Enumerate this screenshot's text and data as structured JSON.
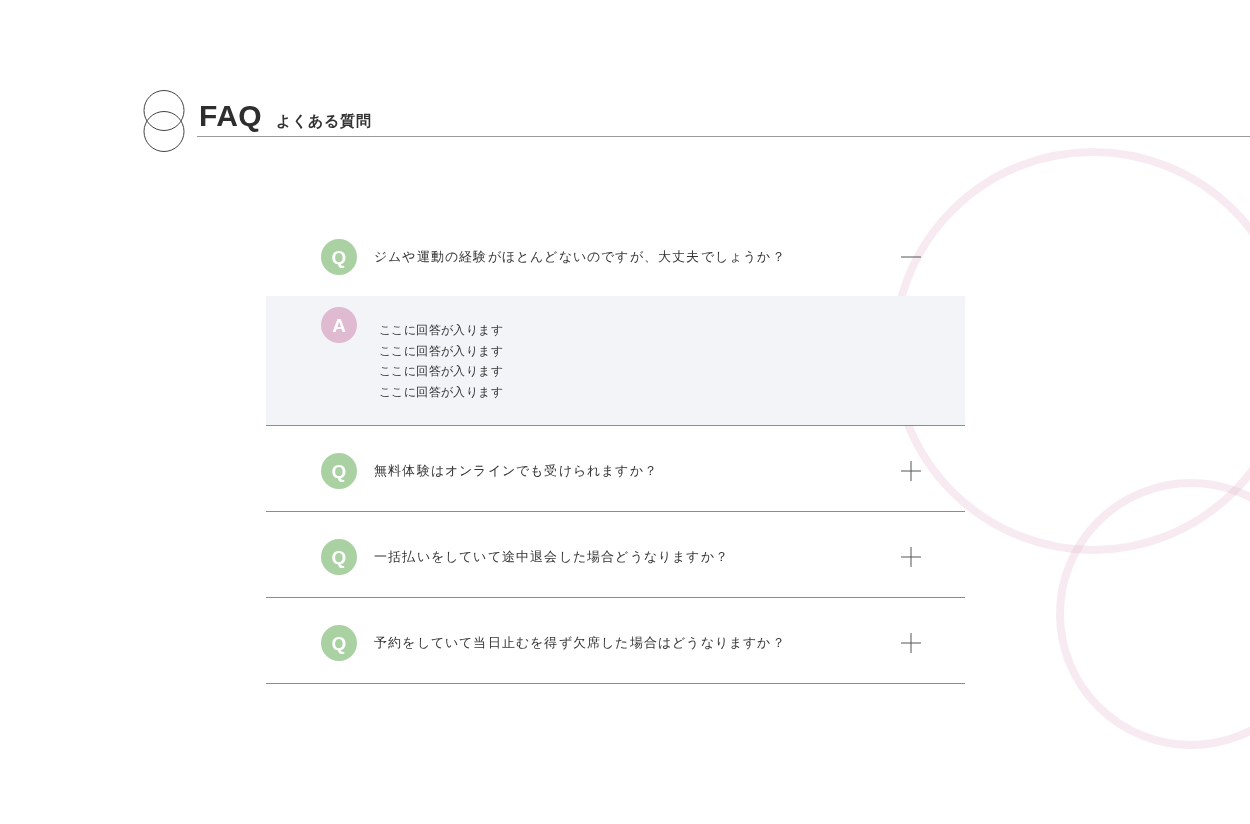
{
  "header": {
    "title": "FAQ",
    "subtitle": "よくある質問"
  },
  "items": [
    {
      "marker": "Q",
      "question": "ジムや運動の経験がほとんどないのですが、大丈夫でしょうか？",
      "expanded": true,
      "answer": {
        "marker": "A",
        "lines": [
          "ここに回答が入ります",
          "ここに回答が入ります",
          "ここに回答が入ります",
          "ここに回答が入ります"
        ]
      }
    },
    {
      "marker": "Q",
      "question": "無料体験はオンラインでも受けられますか？",
      "expanded": false
    },
    {
      "marker": "Q",
      "question": "一括払いをしていて途中退会した場合どうなりますか？",
      "expanded": false
    },
    {
      "marker": "Q",
      "question": "予約をしていて当日止むを得ず欠席した場合はどうなりますか？",
      "expanded": false
    }
  ]
}
